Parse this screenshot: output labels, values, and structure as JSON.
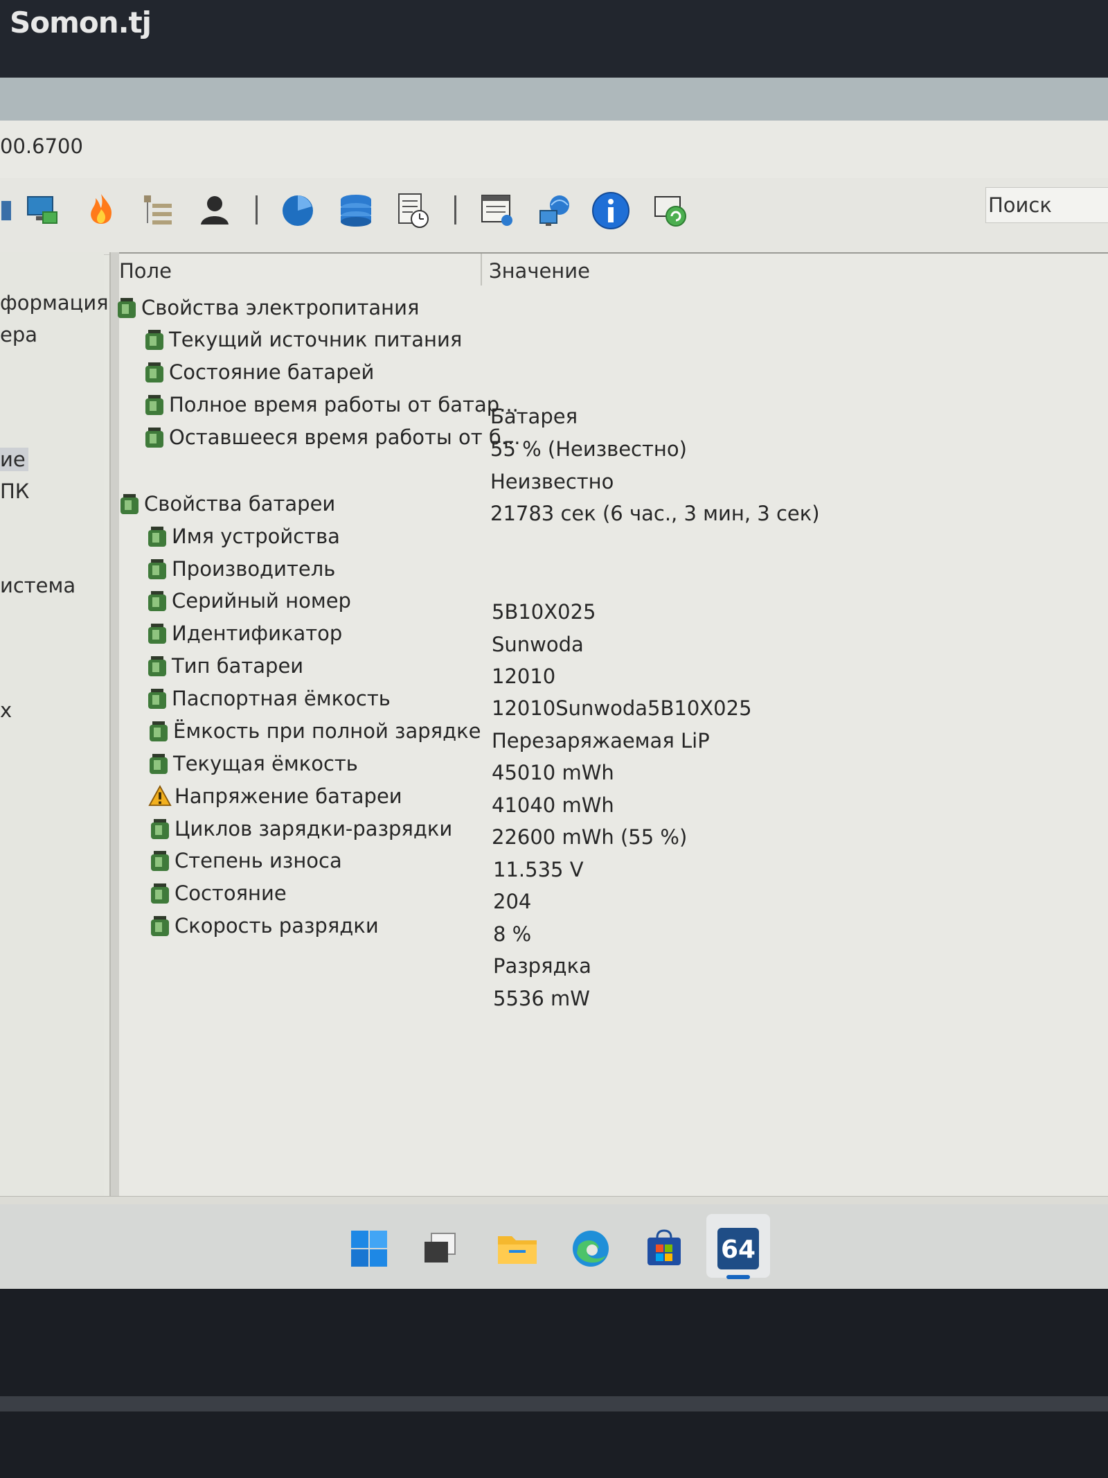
{
  "watermark": "Somon.tj",
  "window": {
    "version_fragment": "00.6700"
  },
  "toolbar": {
    "search_label": "Поиск"
  },
  "sidebar": {
    "items": [
      {
        "label": "формация",
        "selected": false
      },
      {
        "label": "ера",
        "selected": false
      },
      {
        "label": "ие",
        "selected": true
      },
      {
        "label": "ПК",
        "selected": false
      },
      {
        "label": "истема",
        "selected": false
      },
      {
        "label": "х",
        "selected": false
      }
    ]
  },
  "table": {
    "col_field": "Поле",
    "col_value": "Значение",
    "groups": [
      {
        "title": "Свойства электропитания",
        "rows": [
          {
            "field": "Текущий источник питания",
            "value": "Батарея",
            "icon": "battery-icon"
          },
          {
            "field": "Состояние батарей",
            "value": "55 % (Неизвестно)",
            "icon": "battery-icon"
          },
          {
            "field": "Полное время работы от батар...",
            "value": "Неизвестно",
            "icon": "battery-icon"
          },
          {
            "field": "Оставшееся время работы от б...",
            "value": "21783 сек (6 час., 3 мин, 3 сек)",
            "icon": "battery-icon"
          }
        ]
      },
      {
        "title": "Свойства батареи",
        "rows": [
          {
            "field": "Имя устройства",
            "value": "5B10X025",
            "icon": "battery-icon"
          },
          {
            "field": "Производитель",
            "value": "Sunwoda",
            "icon": "battery-icon"
          },
          {
            "field": "Серийный номер",
            "value": "12010",
            "icon": "battery-icon"
          },
          {
            "field": "Идентификатор",
            "value": "12010Sunwoda5B10X025",
            "icon": "battery-icon"
          },
          {
            "field": "Тип батареи",
            "value": "Перезаряжаемая LiP",
            "icon": "battery-icon"
          },
          {
            "field": "Паспортная ёмкость",
            "value": "45010 mWh",
            "icon": "battery-icon"
          },
          {
            "field": "Ёмкость при полной зарядке",
            "value": "41040 mWh",
            "icon": "battery-icon"
          },
          {
            "field": "Текущая ёмкость",
            "value": "22600 mWh  (55 %)",
            "icon": "battery-icon"
          },
          {
            "field": "Напряжение батареи",
            "value": "11.535 V",
            "icon": "warning-icon"
          },
          {
            "field": "Циклов зарядки-разрядки",
            "value": "204",
            "icon": "battery-icon"
          },
          {
            "field": "Степень износа",
            "value": "8 %",
            "icon": "battery-icon"
          },
          {
            "field": "Состояние",
            "value": "Разрядка",
            "icon": "battery-icon"
          },
          {
            "field": "Скорость разрядки",
            "value": "5536 mW",
            "icon": "battery-icon"
          }
        ]
      }
    ]
  },
  "taskbar": {
    "items": [
      {
        "name": "windows-start-icon"
      },
      {
        "name": "task-view-icon"
      },
      {
        "name": "file-explorer-icon"
      },
      {
        "name": "edge-browser-icon"
      },
      {
        "name": "microsoft-store-icon"
      },
      {
        "name": "aida64-icon",
        "label": "64",
        "active": true
      }
    ]
  }
}
